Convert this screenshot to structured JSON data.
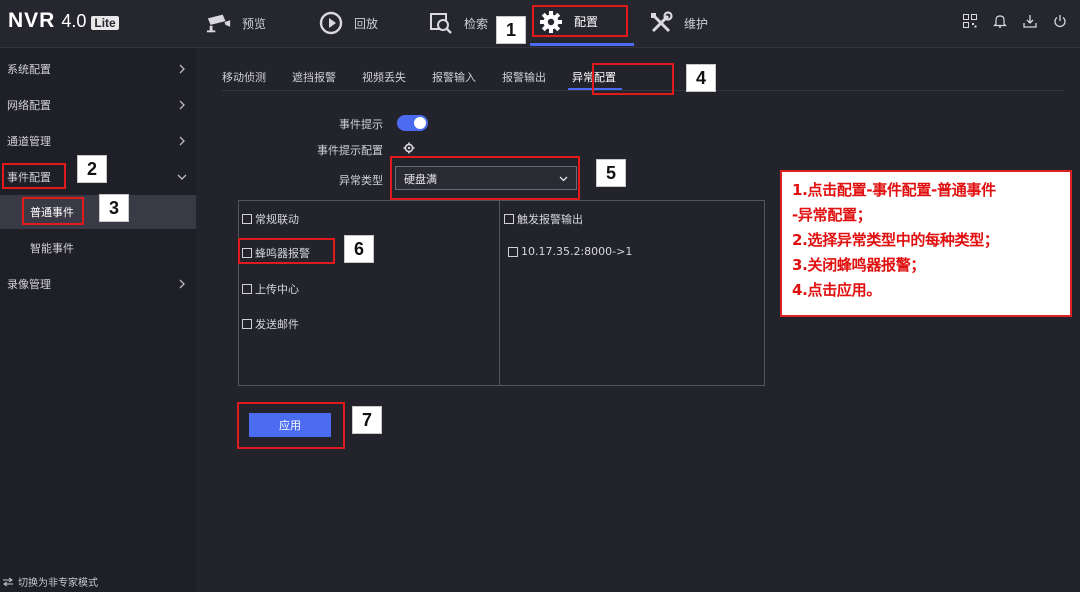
{
  "header": {
    "brand": "NVR",
    "version": "4.0",
    "edition": "Lite",
    "nav": [
      {
        "label": "预览",
        "icon": "camera-icon"
      },
      {
        "label": "回放",
        "icon": "playback-icon"
      },
      {
        "label": "检索",
        "icon": "search-icon"
      },
      {
        "label": "配置",
        "icon": "gear-icon",
        "active": true
      },
      {
        "label": "维护",
        "icon": "tools-icon"
      }
    ],
    "tools": [
      "qr-code-icon",
      "bell-icon",
      "download-icon",
      "power-icon"
    ]
  },
  "sidebar": {
    "items": [
      {
        "label": "系统配置"
      },
      {
        "label": "网络配置"
      },
      {
        "label": "通道管理"
      },
      {
        "label": "事件配置",
        "expanded": true
      },
      {
        "label": "普通事件",
        "active": true
      },
      {
        "label": "智能事件"
      },
      {
        "label": "录像管理"
      }
    ],
    "switch_mode": "切换为非专家模式"
  },
  "tabs": [
    "移动侦测",
    "遮挡报警",
    "视频丢失",
    "报警输入",
    "报警输出",
    "异常配置"
  ],
  "form": {
    "event_hint_label": "事件提示",
    "event_hint_on": true,
    "event_hint_config_label": "事件提示配置",
    "exception_type_label": "异常类型",
    "exception_type_value": "硬盘满"
  },
  "linkage": {
    "left": [
      "常规联动",
      "蜂鸣器报警",
      "上传中心",
      "发送邮件"
    ],
    "right_header": "触发报警输出",
    "right_items": [
      "10.17.35.2:8000->1"
    ]
  },
  "apply_label": "应用",
  "annotations": {
    "numbers": [
      "1",
      "2",
      "3",
      "4",
      "5",
      "6",
      "7"
    ],
    "note": [
      "1.点击配置-事件配置-普通事件",
      "-异常配置；",
      "2.选择异常类型中的每种类型；",
      "3.关闭蜂鸣器报警；",
      "4.点击应用。"
    ]
  },
  "colors": {
    "accent": "#4b6cf0",
    "annotation_red": "#e11b1b",
    "background": "#23232c"
  }
}
